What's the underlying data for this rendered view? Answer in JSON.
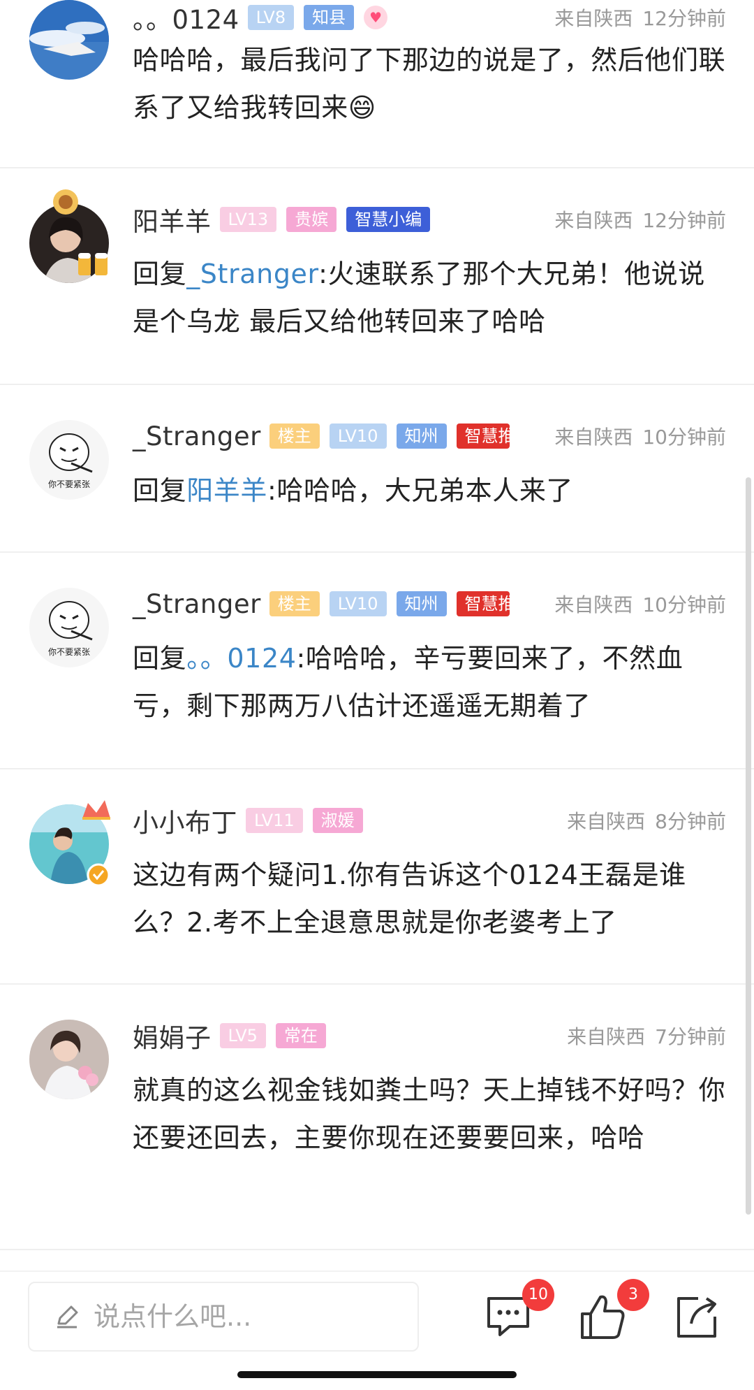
{
  "comments": [
    {
      "name": "。。0124",
      "badges": [
        "LV8",
        "知县"
      ],
      "heart_icon": "heart-icon",
      "location": "来自陕西",
      "time": "12分钟前",
      "text": "哈哈哈，最后我问了下那边的说是了，然后他们联系了又给我转回来😄"
    },
    {
      "name": "阳羊羊",
      "badges": [
        "LV13",
        "贵嫔",
        "智慧小编"
      ],
      "location": "来自陕西",
      "time": "12分钟前",
      "reply_prefix": "回复",
      "mention": "_Stranger",
      "text": ":火速联系了那个大兄弟！他说说是个乌龙 最后又给他转回来了哈哈"
    },
    {
      "name": "_Stranger",
      "badges": [
        "楼主",
        "LV10",
        "知州",
        "智慧推"
      ],
      "location": "来自陕西",
      "time": "10分钟前",
      "reply_prefix": "回复",
      "mention": "阳羊羊",
      "text": ":哈哈哈，大兄弟本人来了"
    },
    {
      "name": "_Stranger",
      "badges": [
        "楼主",
        "LV10",
        "知州",
        "智慧推"
      ],
      "location": "来自陕西",
      "time": "10分钟前",
      "reply_prefix": "回复",
      "mention": "。。0124",
      "text": ":哈哈哈，辛亏要回来了，不然血亏，剩下那两万八估计还遥遥无期着了"
    },
    {
      "name": "小小布丁",
      "badges": [
        "LV11",
        "淑媛"
      ],
      "location": "来自陕西",
      "time": "8分钟前",
      "text": "这边有两个疑问1.你有告诉这个0124王磊是谁么？2.考不上全退意思就是你老婆考上了"
    },
    {
      "name": "娟娟子",
      "badges": [
        "LV5",
        "常在"
      ],
      "location": "来自陕西",
      "time": "7分钟前",
      "text": "就真的这么视金钱如粪土吗？天上掉钱不好吗？你还要还回去，主要你现在还要要回来，哈哈"
    }
  ],
  "bottom_bar": {
    "input_placeholder": "说点什么吧...",
    "comment_count": "10",
    "like_count": "3"
  },
  "colors": {
    "mention": "#3b86c7",
    "badge_red": "#f23c3c"
  }
}
